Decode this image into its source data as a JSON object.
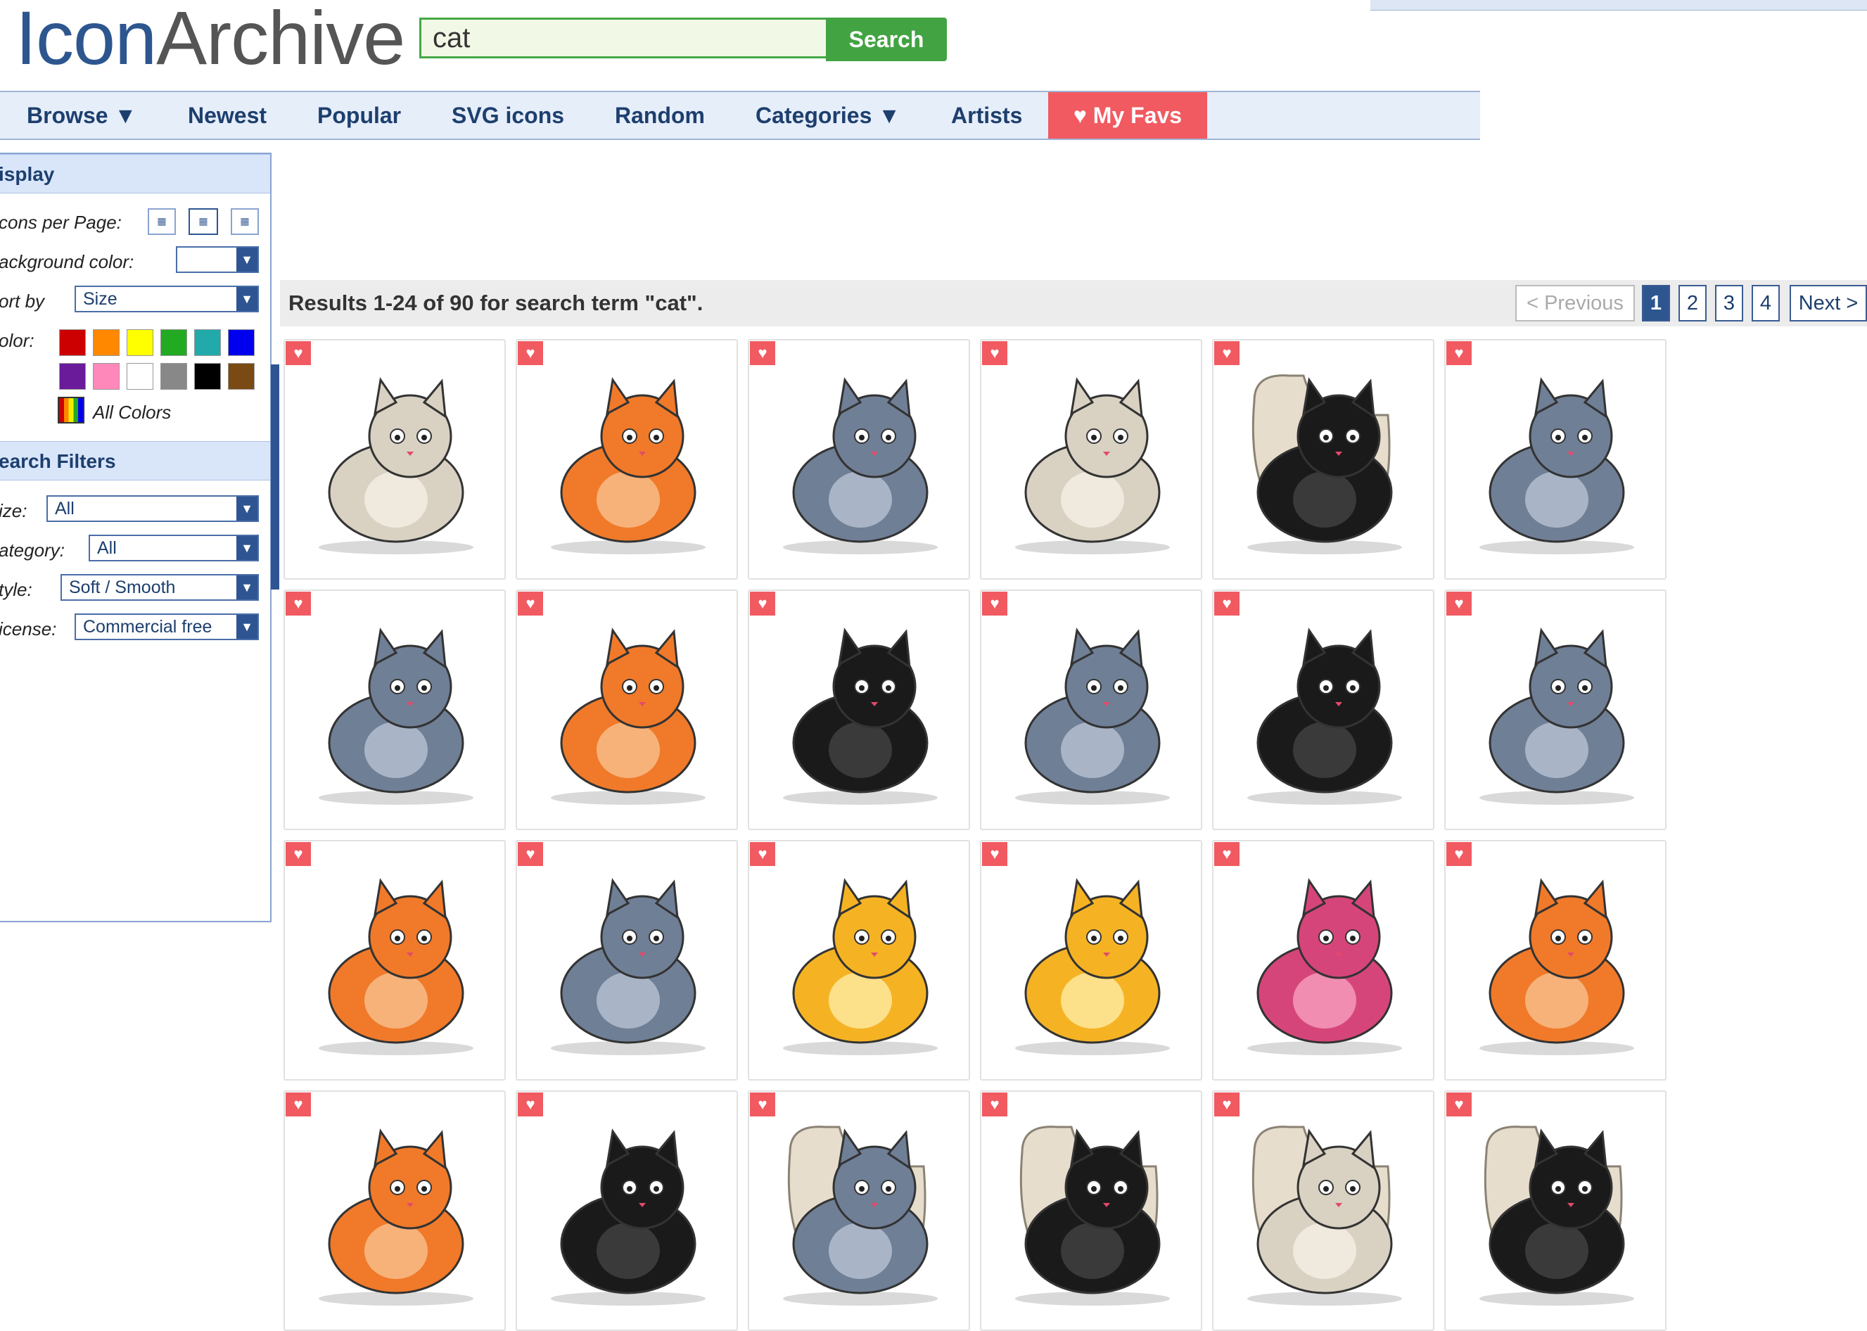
{
  "header": {
    "logo_part1": "Icon",
    "logo_part2": "Archive",
    "search_value": "cat",
    "search_button": "Search"
  },
  "nav": {
    "browse": "Browse ▼",
    "newest": "Newest",
    "popular": "Popular",
    "svg_icons": "SVG icons",
    "random": "Random",
    "categories": "Categories ▼",
    "artists": "Artists",
    "my_favs": "♥ My Favs"
  },
  "sidebar": {
    "display_title": "isplay",
    "icons_per_page_label": "cons per Page:",
    "background_color_label": "ackground color:",
    "sort_by_label": "ort by",
    "sort_by_value": "Size",
    "color_label": "olor:",
    "all_colors": "All Colors",
    "search_filters_title": "earch Filters",
    "size_label": "ize:",
    "size_value": "All",
    "category_label": "ategory:",
    "category_value": "All",
    "style_label": "tyle:",
    "style_value": "Soft / Smooth",
    "license_label": "icense:",
    "license_value": "Commercial free",
    "swatches": [
      "#cc0000",
      "#ff8800",
      "#ffff00",
      "#22aa22",
      "#22aaaa",
      "#0000ee",
      "#6a1b9a",
      "#ff88bb",
      "#ffffff",
      "#888888",
      "#000000",
      "#7a4a14"
    ]
  },
  "results": {
    "summary": "Results 1-24 of 90 for search term \"cat\".",
    "previous": "< Previous",
    "pages": [
      "1",
      "2",
      "3",
      "4"
    ],
    "current_page": "1",
    "next": "Next >"
  },
  "icons": [
    "angel-cat-icon",
    "lovesick-cat-bowl-icon",
    "sleeping-grey-cat-icon",
    "cat-on-laptop-icon",
    "cat-in-toilet-icon",
    "happy-grey-cat-icon",
    "cat-fridge-icon",
    "cat-in-cage-icon",
    "cat-fishbowl-icon",
    "grumpy-grey-cat-icon",
    "cat-litter-box-icon",
    "cat-yarn-ball-icon",
    "orange-cat-bowl-icon",
    "cat-toilet-paper-icon",
    "yellow-cat-face-icon",
    "yellow-kitten-icon",
    "drunk-pink-cat-icon",
    "orange-cat-stretch-icon",
    "pirate-cat-icon",
    "black-cat-silhouette-icon",
    "cat-toilet-birthday-icon",
    "cat-toilet-shark-icon",
    "cat-toilet-diving-icon",
    "cat-toilet-mouse-icon"
  ],
  "colors": {
    "brand": "#2d568f",
    "accent_red": "#f15a61",
    "search_green": "#42a342"
  }
}
